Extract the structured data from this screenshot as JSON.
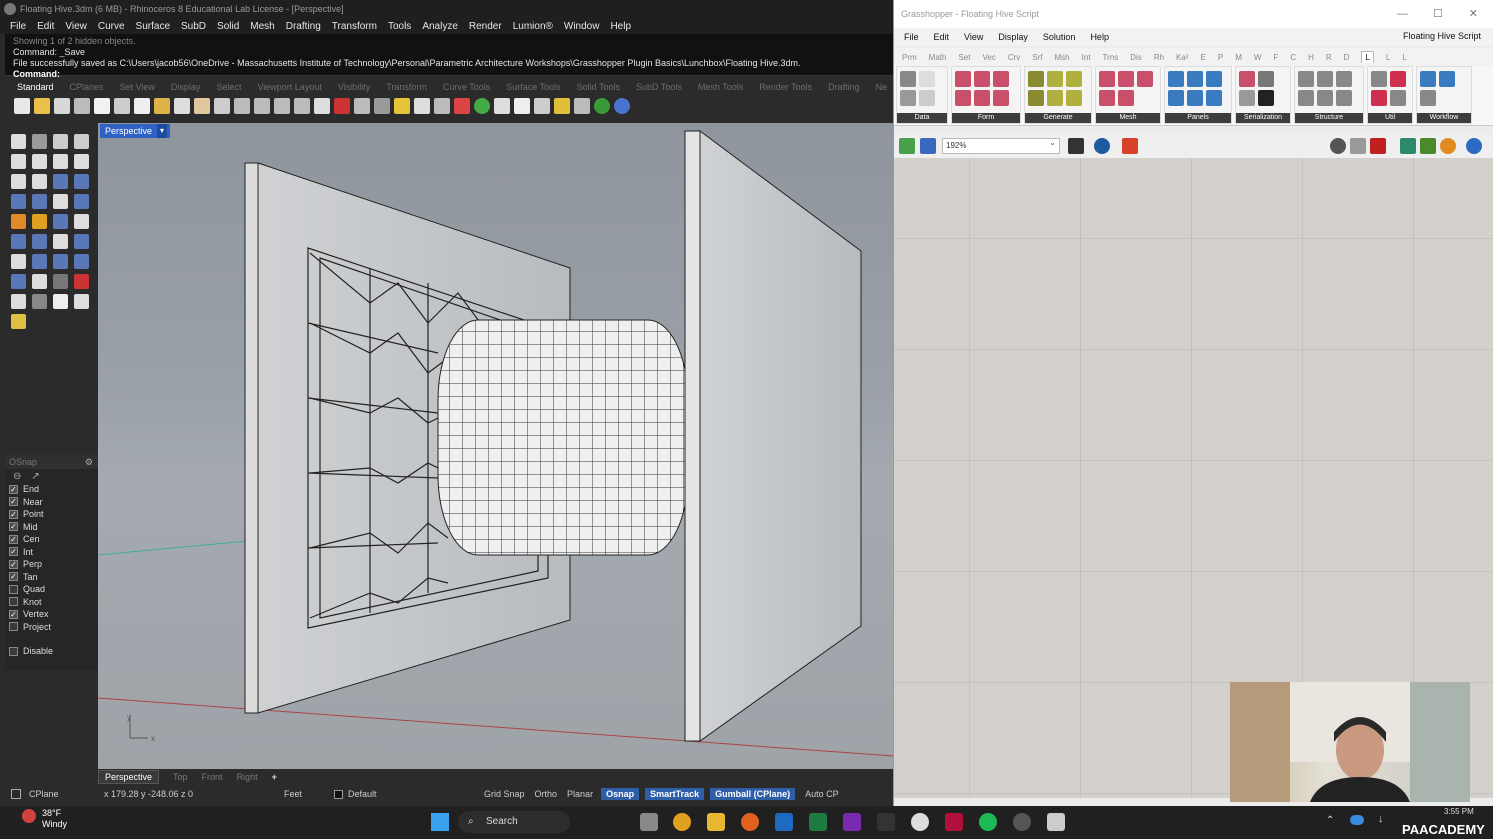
{
  "rhino": {
    "title": "Floating Hive.3dm (6 MB) - Rhinoceros 8 Educational Lab License - [Perspective]",
    "menu": [
      "File",
      "Edit",
      "View",
      "Curve",
      "Surface",
      "SubD",
      "Solid",
      "Mesh",
      "Drafting",
      "Transform",
      "Tools",
      "Analyze",
      "Render",
      "Lumion®",
      "Window",
      "Help"
    ],
    "command_history": [
      "Showing 1 of 2 hidden objects.",
      "Command: _Save",
      "File successfully saved as C:\\Users\\jacob56\\OneDrive - Massachusetts Institute of Technology\\Personal\\Parametric Architecture Workshops\\Grasshopper Plugin Basics\\Lunchbox\\Floating Hive.3dm."
    ],
    "command_prompt": "Command:",
    "toolbar_tabs": [
      "Standard",
      "CPlanes",
      "Set View",
      "Display",
      "Select",
      "Viewport Layout",
      "Visibility",
      "Transform",
      "Curve Tools",
      "Surface Tools",
      "Solid Tools",
      "SubD Tools",
      "Mesh Tools",
      "Render Tools",
      "Drafting",
      "Ne"
    ],
    "active_tab": "Standard",
    "viewport_label": "Perspective",
    "viewport_tabs": [
      "Perspective",
      "Top",
      "Front",
      "Right"
    ],
    "add_tab": "+",
    "axis_x": "x",
    "axis_y": "y",
    "osnap": {
      "title": "OSnap",
      "items": [
        {
          "label": "End",
          "checked": true
        },
        {
          "label": "Near",
          "checked": true
        },
        {
          "label": "Point",
          "checked": true
        },
        {
          "label": "Mid",
          "checked": true
        },
        {
          "label": "Cen",
          "checked": true
        },
        {
          "label": "Int",
          "checked": true
        },
        {
          "label": "Perp",
          "checked": true
        },
        {
          "label": "Tan",
          "checked": true
        },
        {
          "label": "Quad",
          "checked": false
        },
        {
          "label": "Knot",
          "checked": false
        },
        {
          "label": "Vertex",
          "checked": true
        },
        {
          "label": "Project",
          "checked": false
        }
      ],
      "disable": "Disable"
    },
    "status": {
      "cplane": "CPlane",
      "coords": "x 179.28  y -248.06  z 0",
      "units": "Feet",
      "layer": "Default",
      "grid_snap": "Grid Snap",
      "ortho": "Ortho",
      "planar": "Planar",
      "osnap": "Osnap",
      "smarttrack": "SmartTrack",
      "gumball": "Gumball (CPlane)",
      "auto": "Auto CP"
    }
  },
  "grasshopper": {
    "title": "Grasshopper - Floating Hive Script",
    "menu": [
      "File",
      "Edit",
      "View",
      "Display",
      "Solution",
      "Help"
    ],
    "document": "Floating Hive Script",
    "tabs": [
      "Prm",
      "Math",
      "Set",
      "Vec",
      "Crv",
      "Srf",
      "Msh",
      "Int",
      "Trns",
      "Dis",
      "Rh",
      "Ka²",
      "E",
      "P",
      "M",
      "W",
      "F",
      "C",
      "H",
      "R",
      "D",
      "L",
      "L",
      "L"
    ],
    "active_tab_index": 21,
    "groups": [
      "Data",
      "Form",
      "Generate",
      "Mesh",
      "Panels",
      "Serialization",
      "Structure",
      "Util",
      "Workflow"
    ],
    "zoom": "192%"
  },
  "taskbar": {
    "temp": "38°F",
    "weather": "Windy",
    "search": "Search",
    "time": "3:55 PM",
    "brand": "PAACADEMY"
  },
  "colors": {
    "rhino_blue": "#2f62c4",
    "gh_canvas": "#d4d1cc",
    "taskbar": "#202020"
  }
}
